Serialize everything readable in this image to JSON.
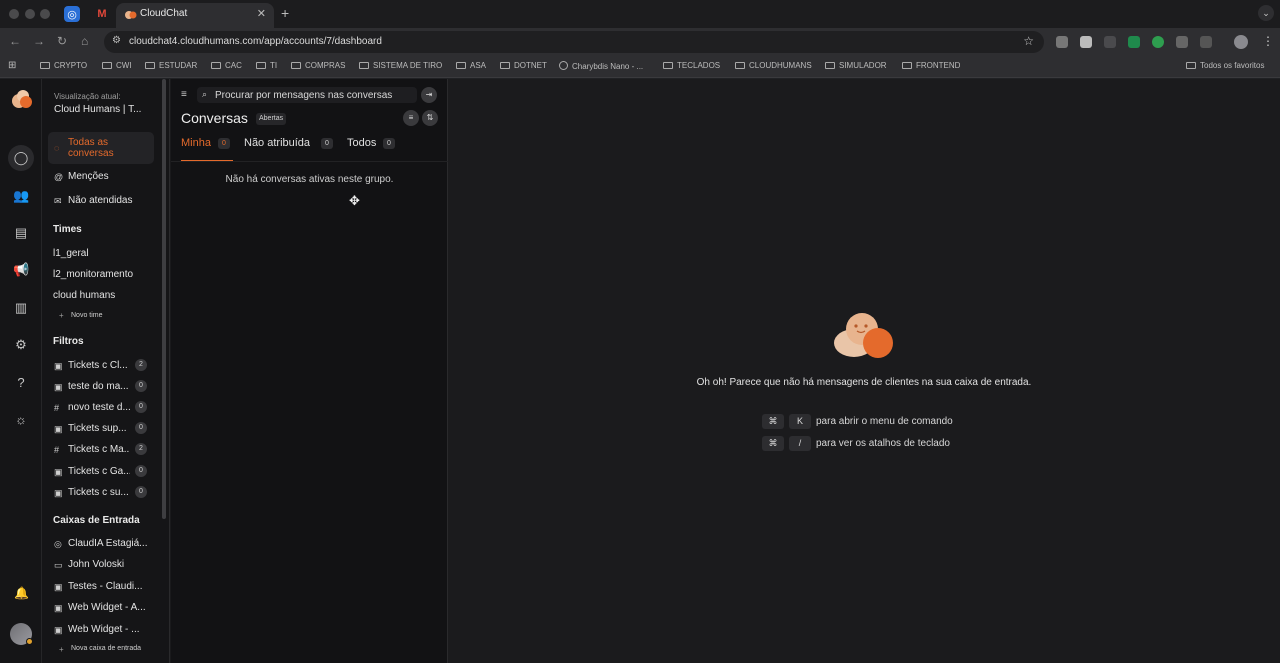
{
  "browser": {
    "active_tab_title": "CloudChat",
    "url": "cloudchat4.cloudhumans.com/app/accounts/7/dashboard",
    "bookmarks": [
      "CRYPTO",
      "CWI",
      "ESTUDAR",
      "CAC",
      "TI",
      "COMPRAS",
      "SISTEMA DE TIRO",
      "ASA",
      "DOTNET",
      "Charybdis Nano - ...",
      "TECLADOS",
      "CLOUDHUMANS",
      "SIMULADOR",
      "FRONTEND"
    ],
    "all_bookmarks": "Todos os favoritos"
  },
  "sidebar": {
    "view_label": "Visualização atual:",
    "account_name": "Cloud Humans | T...",
    "nav": {
      "all_conversations": "Todas as conversas",
      "mentions": "Menções",
      "unattended": "Não atendidas"
    },
    "teams_heading": "Times",
    "teams": [
      "l1_geral",
      "l2_monitoramento",
      "cloud humans"
    ],
    "new_team": "Novo time",
    "filters_heading": "Filtros",
    "filters": [
      {
        "label": "Tickets c Cl...",
        "count": "2",
        "icon": "lock"
      },
      {
        "label": "teste do ma...",
        "count": "0",
        "icon": "lock"
      },
      {
        "label": "novo teste d...",
        "count": "0",
        "icon": "hash"
      },
      {
        "label": "Tickets sup...",
        "count": "0",
        "icon": "lock"
      },
      {
        "label": "Tickets c Ma...",
        "count": "2",
        "icon": "hash"
      },
      {
        "label": "Tickets c Ga...",
        "count": "0",
        "icon": "lock"
      },
      {
        "label": "Tickets c su...",
        "count": "0",
        "icon": "lock"
      }
    ],
    "inboxes_heading": "Caixas de Entrada",
    "inboxes": [
      {
        "label": "ClaudIA Estagiá..."
      },
      {
        "label": "John Voloski"
      },
      {
        "label": "Testes - Claudi..."
      },
      {
        "label": "Web Widget - A..."
      },
      {
        "label": "Web Widget - ..."
      }
    ],
    "new_inbox": "Nova caixa de entrada"
  },
  "conversations": {
    "search_placeholder": "Procurar por mensagens nas conversas",
    "title": "Conversas",
    "status_pill": "Abertas",
    "tabs": [
      {
        "label": "Minha",
        "count": "0"
      },
      {
        "label": "Não atribuída",
        "count": "0"
      },
      {
        "label": "Todos",
        "count": "0"
      }
    ],
    "empty_message": "Não há conversas ativas neste grupo."
  },
  "main": {
    "empty_message": "Oh oh! Parece que não há mensagens de clientes na sua caixa de entrada.",
    "shortcuts": [
      {
        "mod": "⌘",
        "key": "K",
        "text": "para abrir o menu de comando"
      },
      {
        "mod": "⌘",
        "key": "/",
        "text": "para ver os atalhos de teclado"
      }
    ]
  },
  "colors": {
    "accent": "#e46a2c"
  }
}
